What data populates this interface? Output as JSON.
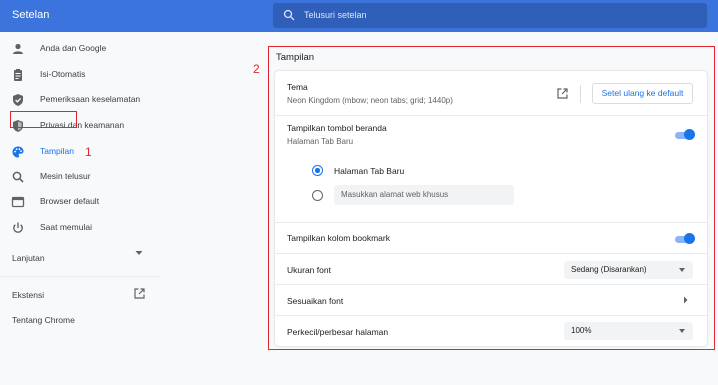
{
  "app": {
    "title": "Setelan"
  },
  "search": {
    "placeholder": "Telusuri setelan"
  },
  "sidebar": {
    "items": [
      {
        "label": "Anda dan Google",
        "icon": "person-icon"
      },
      {
        "label": "Isi-Otomatis",
        "icon": "clipboard-icon"
      },
      {
        "label": "Pemeriksaan keselamatan",
        "icon": "shield-check-icon"
      },
      {
        "label": "Privasi dan keamanan",
        "icon": "shield-icon"
      },
      {
        "label": "Tampilan",
        "icon": "palette-icon",
        "active": true
      },
      {
        "label": "Mesin telusur",
        "icon": "search-icon"
      },
      {
        "label": "Browser default",
        "icon": "browser-icon"
      },
      {
        "label": "Saat memulai",
        "icon": "power-icon"
      }
    ],
    "advanced": "Lanjutan",
    "extensions": "Ekstensi",
    "about": "Tentang Chrome"
  },
  "annotations": {
    "marker1": "1",
    "marker2": "2"
  },
  "appearance": {
    "title": "Tampilan",
    "theme": {
      "label": "Tema",
      "value": "Neon Kingdom (mbow; neon tabs; grid; 1440p)",
      "reset_label": "Setel ulang ke default"
    },
    "home_button": {
      "label": "Tampilkan tombol beranda",
      "sub": "Halaman Tab Baru",
      "enabled": true,
      "option_newtab": "Halaman Tab Baru",
      "option_custom_placeholder": "Masukkan alamat web khusus"
    },
    "bookmarks_bar": {
      "label": "Tampilkan kolom bookmark",
      "enabled": true
    },
    "font_size": {
      "label": "Ukuran font",
      "value": "Sedang (Disarankan)"
    },
    "customize_fonts": {
      "label": "Sesuaikan font"
    },
    "zoom": {
      "label": "Perkecil/perbesar halaman",
      "value": "100%"
    }
  },
  "colors": {
    "accent": "#1a73e8",
    "topbar": "#3b74dc",
    "annotation": "#e0262f"
  }
}
